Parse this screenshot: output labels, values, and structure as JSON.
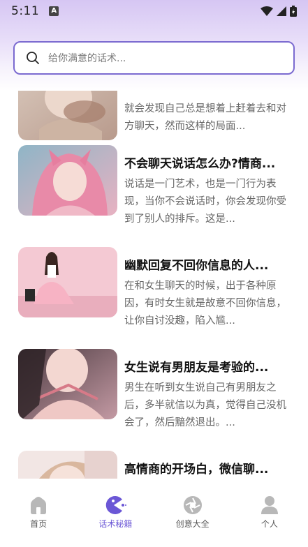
{
  "status": {
    "time": "5:11",
    "notification_icon": "a-letter-icon",
    "right_icons": [
      "wifi-icon",
      "signal-icon",
      "battery-icon"
    ]
  },
  "search": {
    "placeholder": "给你满意的话术...",
    "icon": "search-icon"
  },
  "articles": [
    {
      "title": "",
      "desc": "就会发现自己总是想着上赶着去和对方聊天，然而这样的局面..."
    },
    {
      "title": "不会聊天说话怎么办?情商...",
      "desc": "说话是一门艺术，也是一门行为表现，当你不会说话时，你会发现你受到了别人的排斥。这是..."
    },
    {
      "title": "幽默回复不回你信息的人...",
      "desc": "在和女生聊天的时候，出于各种原因，有时女生就是故意不回你信息，让你自讨没趣，陷入尴..."
    },
    {
      "title": "女生说有男朋友是考验的...",
      "desc": "男生在听到女生说自己有男朋友之后，多半就信以为真，觉得自己没机会了，然后黯然退出。..."
    },
    {
      "title": "高情商的开场白，微信聊...",
      "desc": ""
    }
  ],
  "tabs": [
    {
      "label": "首页",
      "icon": "home-icon"
    },
    {
      "label": "话术秘籍",
      "icon": "pacman-icon"
    },
    {
      "label": "创意大全",
      "icon": "aperture-icon"
    },
    {
      "label": "个人",
      "icon": "person-icon"
    }
  ],
  "colors": {
    "accent": "#6b57d6",
    "search_border": "#7b6ad0",
    "tab_inactive": "#b8b8b8"
  }
}
